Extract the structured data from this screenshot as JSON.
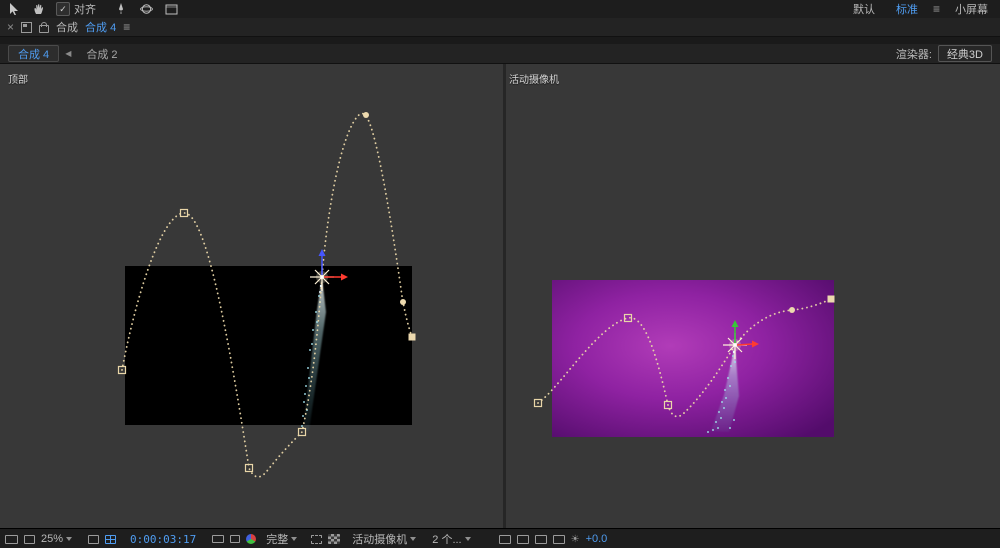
{
  "icons": {
    "close": "×",
    "menu": "≡",
    "tab_scroll": "◀",
    "check": "✓",
    "exposure_sun": "☀"
  },
  "toolbar": {
    "align_label": "对齐",
    "workspace_default": "默认",
    "workspace_active": "标准",
    "screen_mode": "小屏幕"
  },
  "panel_header": {
    "panel_type": "合成",
    "comp_name": "合成 4"
  },
  "comp_tabs": {
    "active_tab": "合成 4",
    "inactive_tab": "合成 2",
    "renderer_label": "渲染器:",
    "renderer_value": "经典3D"
  },
  "viewers": {
    "left_label": "顶部",
    "right_label": "活动摄像机"
  },
  "statusbar": {
    "zoom": "25%",
    "timecode": "0:00:03:17",
    "resolution": "完整",
    "view_name": "活动摄像机",
    "view_layout": "2 个...",
    "exposure": "+0.0"
  },
  "colors": {
    "accent_blue": "#4f9cf0",
    "path_beige": "#e9d6a8",
    "axis_red": "#ff3b30",
    "axis_green": "#37c837",
    "axis_blue": "#4656ff",
    "trail_cyan": "#9fdde8",
    "comp_purple_center": "#b13cb8",
    "comp_purple_edge": "#530c6b"
  }
}
